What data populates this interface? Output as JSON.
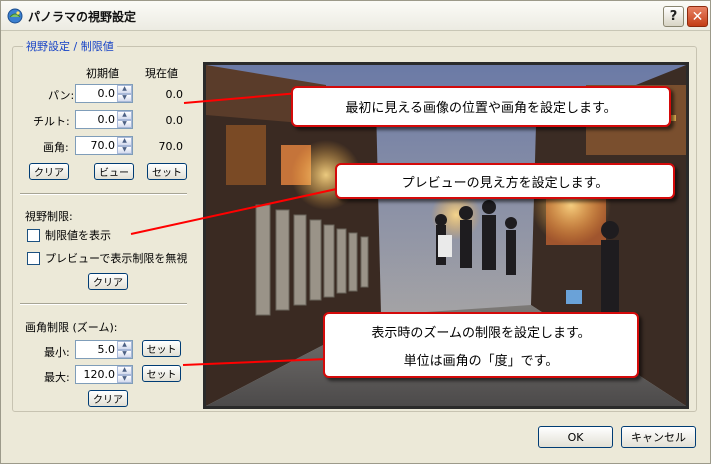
{
  "window": {
    "title": "パノラマの視野設定"
  },
  "titlebar": {
    "help_label": "?",
    "close_label": "✕"
  },
  "group": {
    "legend": "視野設定 / 制限値"
  },
  "columns": {
    "initial": "初期値",
    "current": "現在値"
  },
  "rows": {
    "pan": {
      "label": "パン:",
      "value": "0.0",
      "current": "0.0"
    },
    "tilt": {
      "label": "チルト:",
      "value": "0.0",
      "current": "0.0"
    },
    "fov": {
      "label": "画角:",
      "value": "70.0",
      "current": "70.0"
    }
  },
  "view_buttons": {
    "clear": "クリア",
    "view": "ビュー",
    "set": "セット"
  },
  "view_limit": {
    "title": "視野制限:",
    "show_limit": {
      "label": "制限値を表示",
      "checked": false
    },
    "ignore_preview": {
      "label": "プレビューで表示制限を無視",
      "checked": false
    },
    "clear": "クリア"
  },
  "fov_limit": {
    "title": "画角制限 (ズーム):",
    "min": {
      "label": "最小:",
      "value": "5.0",
      "set": "セット"
    },
    "max": {
      "label": "最大:",
      "value": "120.0",
      "set": "セット"
    },
    "clear": "クリア"
  },
  "footer": {
    "ok": "OK",
    "cancel": "キャンセル"
  },
  "callouts": {
    "top": "最初に見える画像の位置や画角を設定します。",
    "middle": "プレビューの見え方を設定します。",
    "bottom_line1": "表示時のズームの制限を設定します。",
    "bottom_line2": "単位は画角の「度」です。"
  },
  "colors": {
    "callout_border": "#d40a0a",
    "pointer": "#ff0000",
    "legend": "#1743c6",
    "window_bg": "#ece9d8"
  }
}
